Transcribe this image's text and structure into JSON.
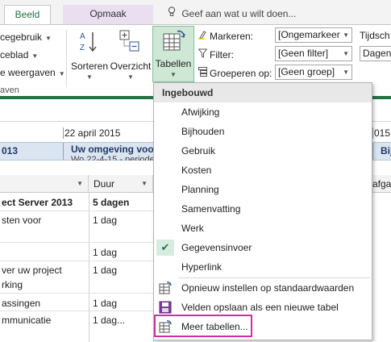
{
  "tabs": {
    "beeld": "Beeld",
    "opmaak": "Opmaak"
  },
  "tellme": {
    "placeholder": "Geef aan wat u wilt doen..."
  },
  "ribbon": {
    "left_items": [
      "cegebruik",
      "ceblad",
      "e weergaven"
    ],
    "group_label": "aven",
    "sorteren": "Sorteren",
    "overzicht": "Overzicht",
    "tabellen": "Tabellen",
    "markeren_label": "Markeren:",
    "filter_label": "Filter:",
    "groeperen_label": "Groeperen op:",
    "markeren_value": "[Ongemarkeer",
    "filter_value": "[Geen filter]",
    "groeperen_value": "[Geen groep]",
    "tijdschaal_label": "Tijdsch",
    "tijdschaal_value": "Dagen"
  },
  "timeline": {
    "date_left": "22 april 2015",
    "date_right": "015",
    "year_cell": "013",
    "task_text": "Uw omgeving voort",
    "task_sub": "Wo 22-4-15 - periode",
    "right_cut": "Bij"
  },
  "grid": {
    "col_duur": "Duur",
    "col_right": "afgaa",
    "rows": [
      {
        "name": "ect Server 2013",
        "duur": "5 dagen",
        "bold": true
      },
      {
        "name": "sten voor",
        "duur": "1 dag"
      },
      {
        "name": "",
        "duur": "1 dag"
      },
      {
        "name": "ver uw project",
        "duur": "1 dag"
      },
      {
        "name": "rking",
        "duur": ""
      },
      {
        "name": "assingen",
        "duur": "1 dag"
      },
      {
        "name": "mmunicatie",
        "duur": "1 dag..."
      }
    ]
  },
  "menu": {
    "header": "Ingebouwd",
    "items": [
      "Afwijking",
      "Bijhouden",
      "Gebruik",
      "Kosten",
      "Planning",
      "Samenvatting",
      "Werk",
      "Gegevensinvoer",
      "Hyperlink"
    ],
    "checked_item": "Gegevensinvoer",
    "actions": [
      "Opnieuw instellen op standaardwaarden",
      "Velden opslaan als een nieuwe tabel",
      "Meer tabellen..."
    ]
  },
  "colors": {
    "accent": "#217346",
    "highlight": "#d62c9e",
    "tab_opmaak": "#e9dff0"
  }
}
